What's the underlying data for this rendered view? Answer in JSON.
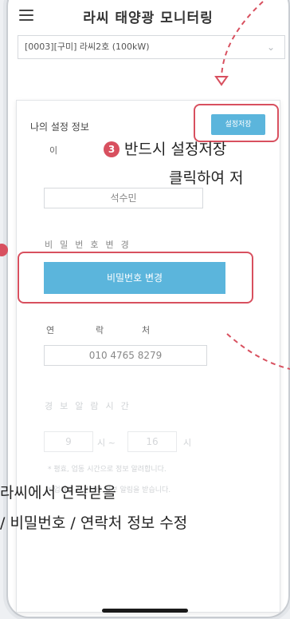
{
  "app": {
    "title": "라씨 태양광 모니터링",
    "site_select_value": "[0003][구미] 라씨2호 (100kW)"
  },
  "settings": {
    "section_title": "나의 설정 정보",
    "save_button": "설정저장",
    "name_label": "이",
    "name_value": "석수민",
    "password_label": "비밀번호변경",
    "password_button": "비밀번호 변경",
    "contact_label_1": "연",
    "contact_label_2": "락",
    "contact_label_3": "처",
    "contact_value": "010 4765 8279",
    "alarm_label": "경보알람시간",
    "alarm_start": "9",
    "alarm_mid": "시 ~",
    "alarm_end": "16",
    "alarm_end_suffix": "시",
    "alarm_note_1": "* 평효, 업동 시간으로 정보 알려합니다.",
    "alarm_note_2": "* 업체된 시간으로 정보 알림을 받습니다."
  },
  "annotations": {
    "step_number": "3",
    "callout_line1": "반드시 설정저장",
    "callout_line2": "클릭하여 저",
    "bottom_line1": "라씨에서 연락받을",
    "bottom_line2": "/ 비밀번호 / 연락처 정보 수정"
  },
  "colors": {
    "accent": "#5bb5dc",
    "highlight": "#d8505f"
  }
}
